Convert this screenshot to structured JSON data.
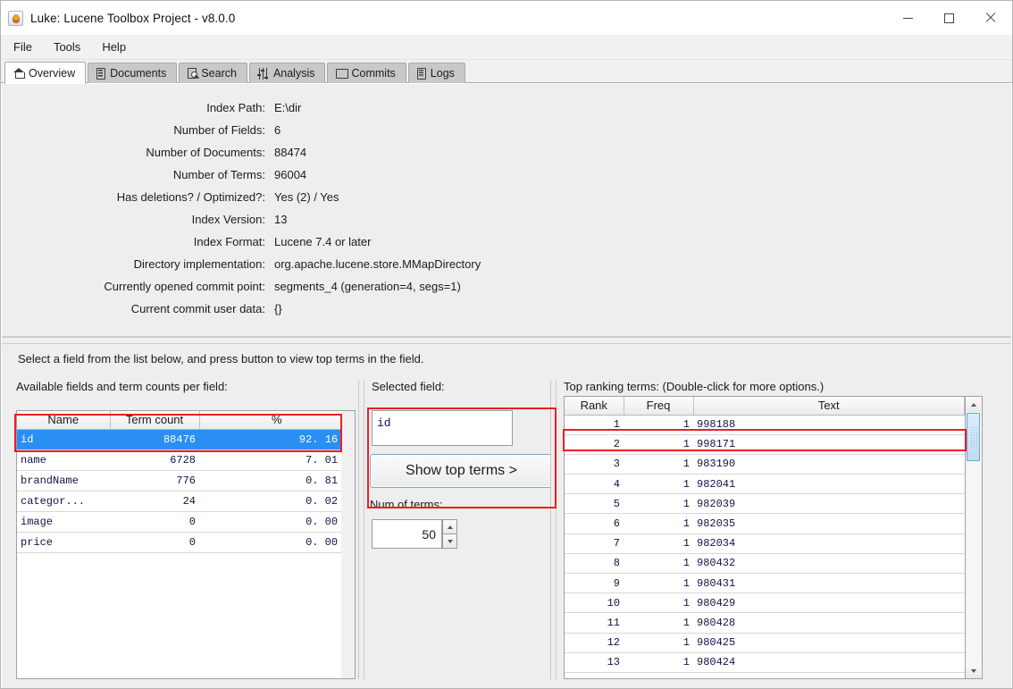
{
  "window": {
    "title": "Luke: Lucene Toolbox Project - v8.0.0",
    "icon": "luke-app-icon",
    "controls": {
      "minimize": "minimize-icon",
      "maximize": "maximize-icon",
      "close": "close-icon"
    }
  },
  "menubar": {
    "items": [
      "File",
      "Tools",
      "Help"
    ]
  },
  "tabs": [
    {
      "label": "Overview",
      "icon": "home-icon",
      "active": true
    },
    {
      "label": "Documents",
      "icon": "document-icon",
      "active": false
    },
    {
      "label": "Search",
      "icon": "search-icon",
      "active": false
    },
    {
      "label": "Analysis",
      "icon": "sliders-icon",
      "active": false
    },
    {
      "label": "Commits",
      "icon": "monitor-icon",
      "active": false
    },
    {
      "label": "Logs",
      "icon": "logs-icon",
      "active": false
    }
  ],
  "overview": {
    "rows": [
      {
        "label": "Index Path:",
        "value": "E:\\dir"
      },
      {
        "label": "Number of Fields:",
        "value": "6"
      },
      {
        "label": "Number of Documents:",
        "value": "88474"
      },
      {
        "label": "Number of Terms:",
        "value": "96004"
      },
      {
        "label": "Has deletions? / Optimized?:",
        "value": "Yes (2) / Yes"
      },
      {
        "label": "Index Version:",
        "value": "13"
      },
      {
        "label": "Index Format:",
        "value": "Lucene 7.4 or later"
      },
      {
        "label": "Directory implementation:",
        "value": "org.apache.lucene.store.MMapDirectory"
      },
      {
        "label": "Currently opened commit point:",
        "value": "segments_4 (generation=4, segs=1)"
      },
      {
        "label": "Current commit user data:",
        "value": "{}"
      }
    ]
  },
  "bottom": {
    "hint": "Select a field from the list below, and press button to view top terms in the field.",
    "fields_caption": "Available fields and term counts per field:",
    "fields_table": {
      "columns": [
        "Name",
        "Term count",
        "%"
      ],
      "rows": [
        {
          "name": "id",
          "count": "88476",
          "pct": "92. 16 %",
          "selected": true
        },
        {
          "name": "name",
          "count": "6728",
          "pct": "7. 01 %",
          "selected": false
        },
        {
          "name": "brandName",
          "count": "776",
          "pct": "0. 81 %",
          "selected": false
        },
        {
          "name": "categor...",
          "count": "24",
          "pct": "0. 02 %",
          "selected": false
        },
        {
          "name": "image",
          "count": "0",
          "pct": "0. 00 %",
          "selected": false
        },
        {
          "name": "price",
          "count": "0",
          "pct": "0. 00 %",
          "selected": false
        }
      ]
    },
    "selected_field_caption": "Selected field:",
    "selected_field_value": "id",
    "show_top_terms_button": "Show top terms >",
    "num_of_terms_caption": "Num of terms:",
    "num_of_terms_value": "50",
    "spinner": {
      "up": "spinner-up-icon",
      "down": "spinner-down-icon"
    },
    "terms_caption": "Top ranking terms: (Double-click for more options.)",
    "terms_table": {
      "columns": [
        "Rank",
        "Freq",
        "Text"
      ],
      "rows": [
        {
          "rank": "1",
          "freq": "1",
          "text": "998188",
          "highlighted": true
        },
        {
          "rank": "2",
          "freq": "1",
          "text": "998171",
          "highlighted": false
        },
        {
          "rank": "3",
          "freq": "1",
          "text": "983190",
          "highlighted": false
        },
        {
          "rank": "4",
          "freq": "1",
          "text": "982041",
          "highlighted": false
        },
        {
          "rank": "5",
          "freq": "1",
          "text": "982039",
          "highlighted": false
        },
        {
          "rank": "6",
          "freq": "1",
          "text": "982035",
          "highlighted": false
        },
        {
          "rank": "7",
          "freq": "1",
          "text": "982034",
          "highlighted": false
        },
        {
          "rank": "8",
          "freq": "1",
          "text": "980432",
          "highlighted": false
        },
        {
          "rank": "9",
          "freq": "1",
          "text": "980431",
          "highlighted": false
        },
        {
          "rank": "10",
          "freq": "1",
          "text": "980429",
          "highlighted": false
        },
        {
          "rank": "11",
          "freq": "1",
          "text": "980428",
          "highlighted": false
        },
        {
          "rank": "12",
          "freq": "1",
          "text": "980425",
          "highlighted": false
        },
        {
          "rank": "13",
          "freq": "1",
          "text": "980424",
          "highlighted": false
        }
      ]
    },
    "scrollbar": {
      "up": "scroll-up-icon",
      "down": "scroll-down-icon"
    }
  },
  "colors": {
    "selection_blue": "#2a8ff2",
    "annotation_red": "#ee1c25",
    "panel_gray": "#eeeeee",
    "tab_inactive": "#c8c8c8"
  }
}
